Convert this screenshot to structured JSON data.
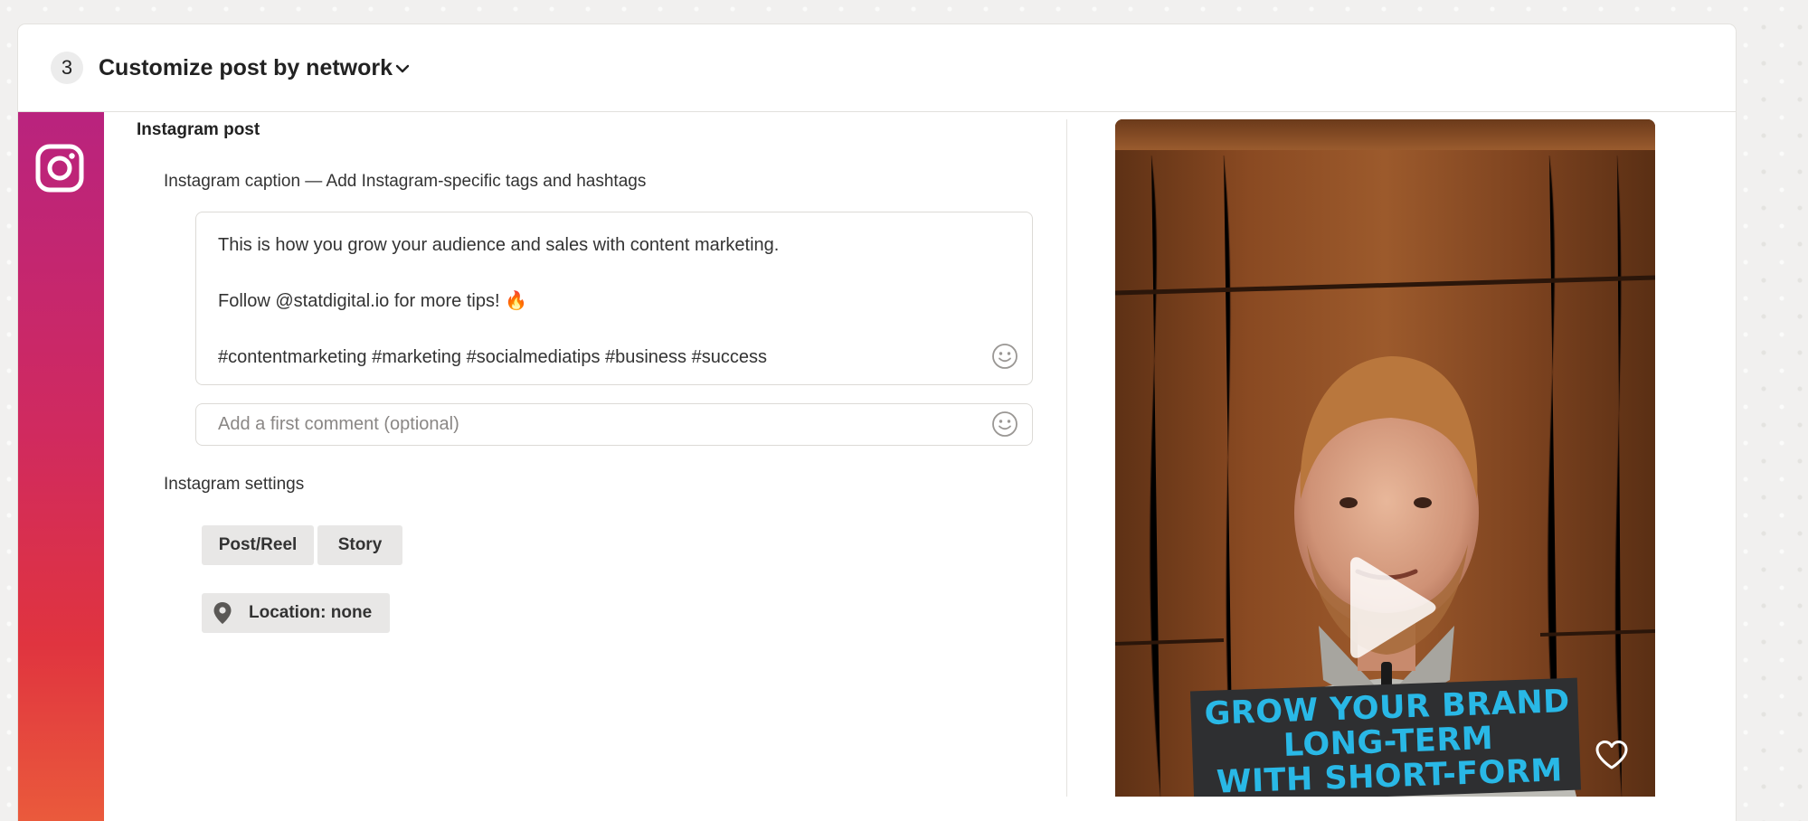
{
  "step": {
    "number": "3",
    "title": "Customize post by network"
  },
  "network": {
    "icon": "instagram-icon",
    "brand_gradient": [
      "#b9237e",
      "#d02a5f",
      "#e0343f",
      "#ea5a3c"
    ]
  },
  "instagram": {
    "section_title": "Instagram post",
    "caption_label": "Instagram caption — Add Instagram-specific tags and hashtags",
    "caption_lines": [
      "This is how you grow your audience and sales with content marketing.",
      "Follow @statdigital.io for more tips! 🔥",
      "#contentmarketing #marketing #socialmediatips #business #success"
    ],
    "comment_placeholder": "Add a first comment (optional)",
    "settings_label": "Instagram settings",
    "post_type_options": [
      "Post/Reel",
      "Story"
    ],
    "location_label": "Location: none"
  },
  "preview": {
    "overlay_lines": [
      "GROW YOUR BRAND",
      "LONG-TERM",
      "WITH SHORT-FORM"
    ],
    "overlay_color": "#29b8e6",
    "icons": [
      "play-icon",
      "heart-icon"
    ]
  }
}
